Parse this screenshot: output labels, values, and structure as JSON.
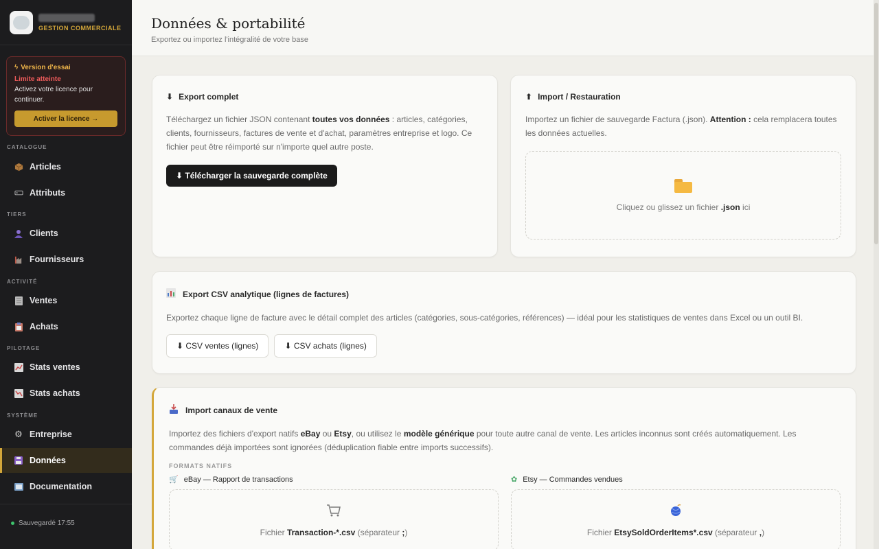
{
  "brand": {
    "subtitle": "GESTION COMMERCIALE"
  },
  "trial": {
    "title": "Version d'essai",
    "limit": "Limite atteinte",
    "text": "Activez votre licence pour continuer.",
    "button": "Activer la licence →"
  },
  "sidebar": {
    "sections": [
      "CATALOGUE",
      "TIERS",
      "ACTIVITÉ",
      "PILOTAGE",
      "SYSTÈME"
    ],
    "items": [
      {
        "label": "Articles"
      },
      {
        "label": "Attributs"
      },
      {
        "label": "Clients"
      },
      {
        "label": "Fournisseurs"
      },
      {
        "label": "Ventes"
      },
      {
        "label": "Achats"
      },
      {
        "label": "Stats ventes"
      },
      {
        "label": "Stats achats"
      },
      {
        "label": "Entreprise"
      },
      {
        "label": "Données"
      },
      {
        "label": "Documentation"
      }
    ],
    "active": "Données",
    "footer": "Sauvegardé 17:55"
  },
  "header": {
    "title": "Données & portabilité",
    "subtitle": "Exportez ou importez l'intégralité de votre base"
  },
  "export_full": {
    "title": "Export complet",
    "text_1": "Téléchargez un fichier JSON contenant ",
    "text_bold": "toutes vos données",
    "text_2": " : articles, catégories, clients, fournisseurs, factures de vente et d'achat, paramètres entreprise et logo. Ce fichier peut être réimporté sur n'importe quel autre poste.",
    "button": "⬇ Télécharger la sauvegarde complète"
  },
  "import_restore": {
    "title": "Import / Restauration",
    "text_1": "Importez un fichier de sauvegarde Factura (.json). ",
    "text_bold": "Attention :",
    "text_2": " cela remplacera toutes les données actuelles.",
    "drop_1": "Cliquez ou glissez un fichier ",
    "drop_bold": ".json",
    "drop_2": " ici"
  },
  "csv_export": {
    "title": "Export CSV analytique (lignes de factures)",
    "text": "Exportez chaque ligne de facture avec le détail complet des articles (catégories, sous-catégories, références) — idéal pour les statistiques de ventes dans Excel ou un outil BI.",
    "btn_sales": "⬇ CSV ventes (lignes)",
    "btn_purchases": "⬇ CSV achats (lignes)"
  },
  "channels": {
    "title": "Import canaux de vente",
    "text_1": "Importez des fichiers d'export natifs ",
    "ebay": "eBay",
    "text_or": " ou ",
    "etsy": "Etsy",
    "text_2": ", ou utilisez le ",
    "generic": "modèle générique",
    "text_3": " pour toute autre canal de vente. Les articles inconnus sont créés automatiquement. Les commandes déjà importées sont ignorées (déduplication fiable entre imports successifs).",
    "formats_label": "FORMATS NATIFS",
    "ebay_title": "eBay — Rapport de transactions",
    "etsy_title": "Etsy — Commandes vendues",
    "ebay_file_1": "Fichier ",
    "ebay_file_bold": "Transaction-*.csv",
    "ebay_file_2": " (séparateur ",
    "ebay_sep": ";",
    "ebay_file_3": ")",
    "etsy_file_1": "Fichier ",
    "etsy_file_bold": "EtsySoldOrderItems*.csv",
    "etsy_file_2": " (séparateur ",
    "etsy_sep": ",",
    "etsy_file_3": ")"
  }
}
